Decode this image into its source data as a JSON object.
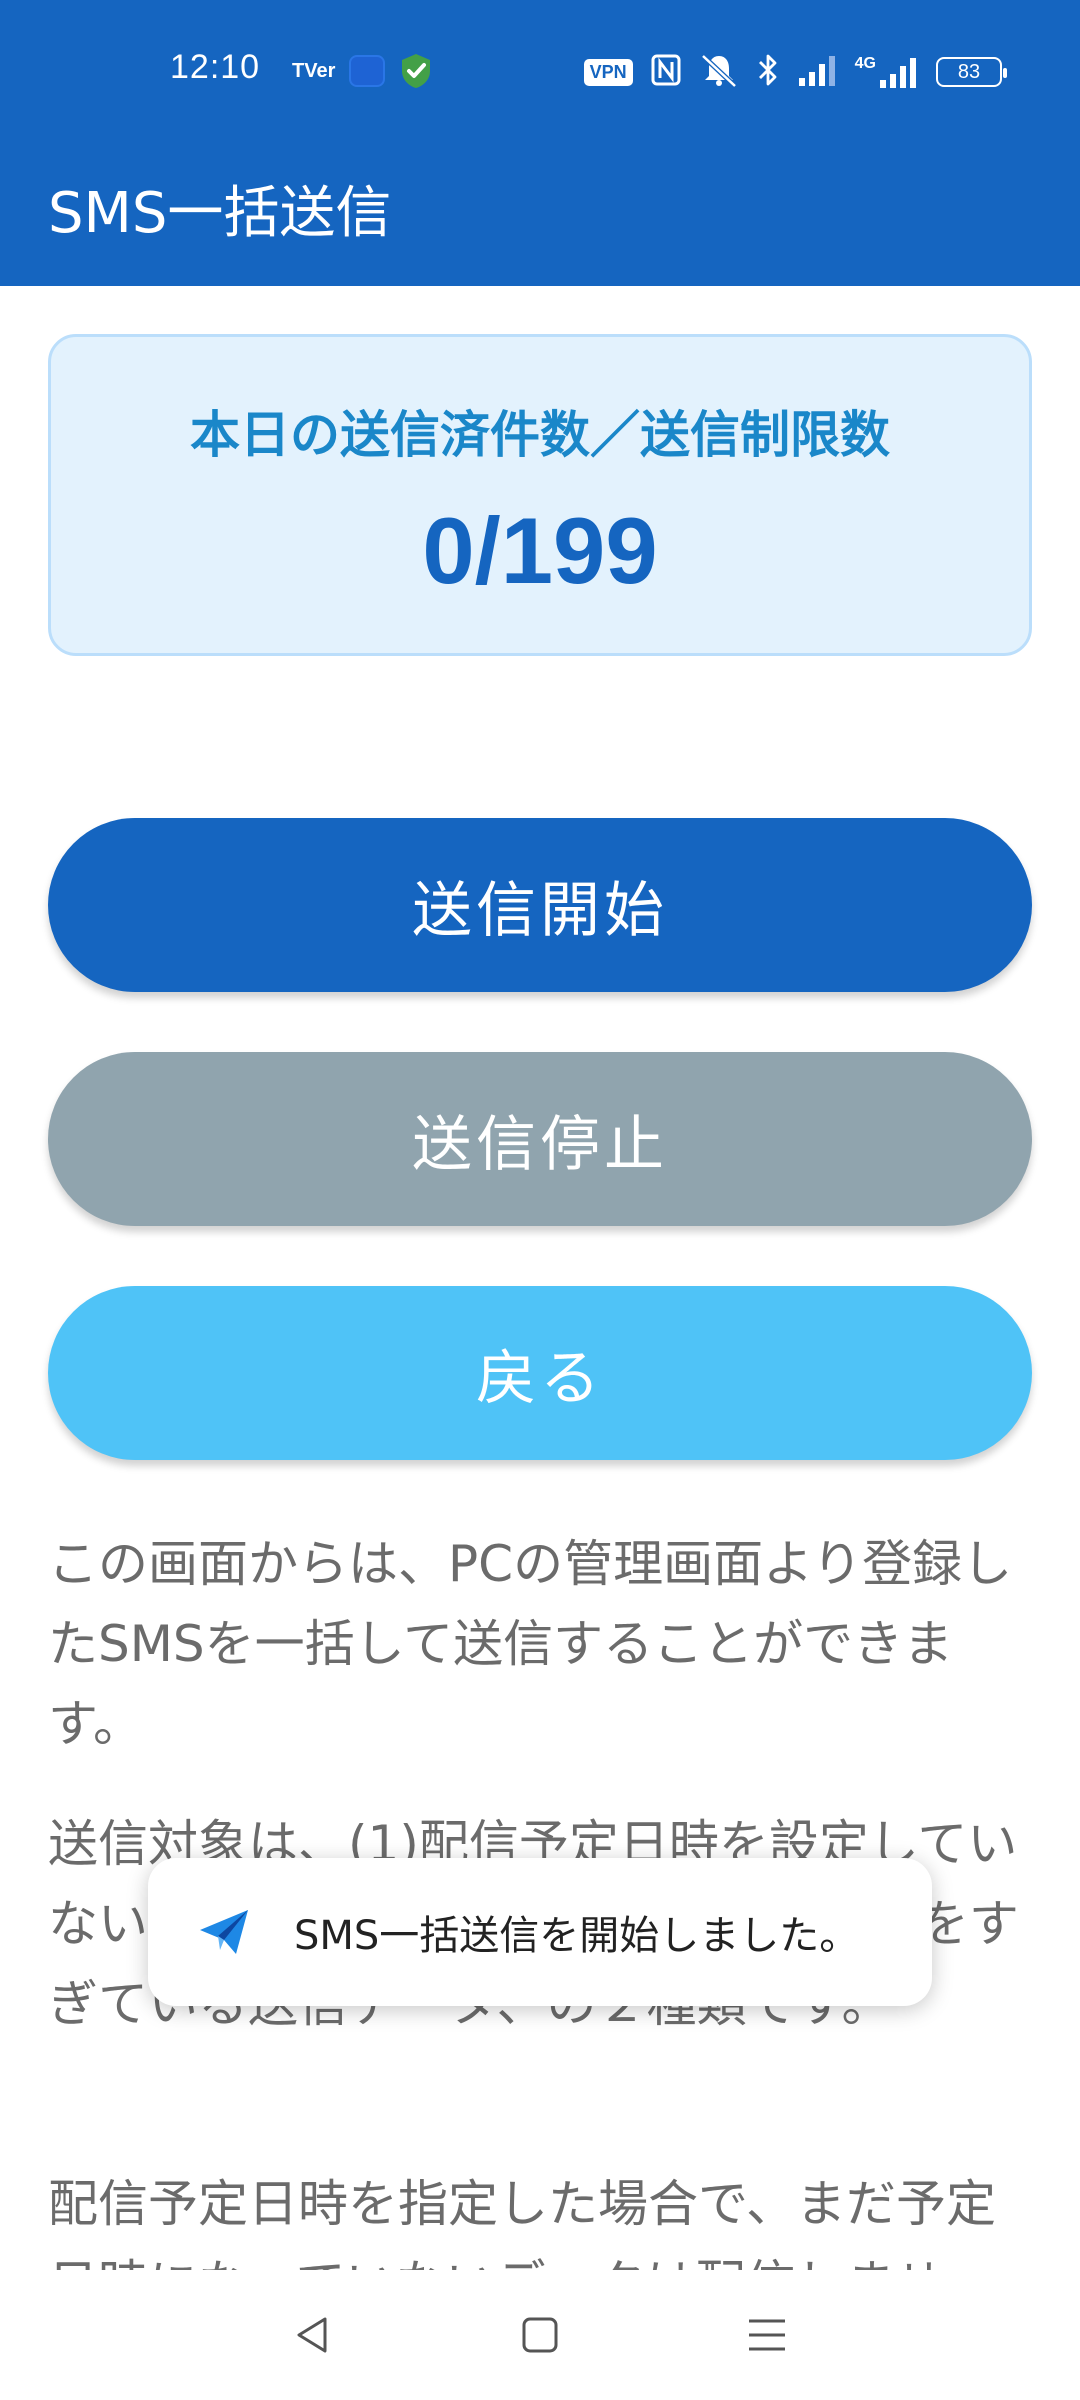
{
  "status_bar": {
    "time": "12:10",
    "tver_label": "TVer",
    "vpn_label": "VPN",
    "network_label": "4G",
    "battery_level": "83",
    "icons": [
      "tver-icon",
      "blue-app-icon",
      "shield-check-icon",
      "vpn-icon",
      "nfc-icon",
      "bell-mute-icon",
      "bluetooth-icon",
      "signal-icon",
      "signal-4g-icon",
      "battery-icon"
    ]
  },
  "app_bar": {
    "title": "SMS一括送信"
  },
  "counter": {
    "label": "本日の送信済件数／送信制限数",
    "value": "0/199"
  },
  "buttons": {
    "start": "送信開始",
    "stop": "送信停止",
    "back": "戻る"
  },
  "description": {
    "p1": "この画面からは、PCの管理画面より登録したSMSを一括して送信することができます。",
    "p2": "送信対象は、(1)配信予定日時を設定していないもの、(2)現在時刻が配信予定時刻をすぎている送信データ、の２種類です。",
    "p3": "配信予定日時を指定した場合で、まだ予定日時になっていないデータは配信しません。"
  },
  "toast": {
    "message": "SMS一括送信を開始しました。"
  },
  "colors": {
    "primary": "#1565c0",
    "stop_button": "#90a4ae",
    "back_button": "#4fc3f7",
    "card_bg": "#e3f2fd",
    "card_label": "#1a87c9"
  }
}
